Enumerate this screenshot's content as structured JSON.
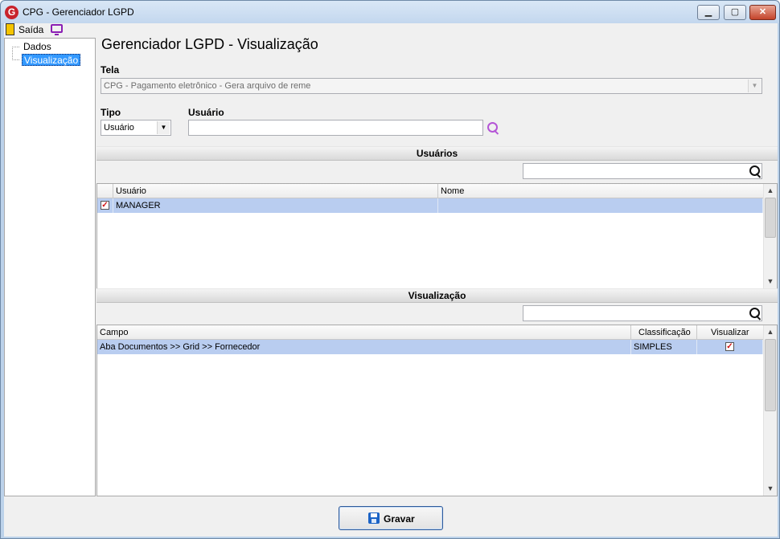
{
  "window": {
    "title": "CPG - Gerenciador LGPD",
    "app_icon_letter": "G"
  },
  "window_controls": {
    "minimize": "▁",
    "maximize": "▢",
    "close": "✕"
  },
  "toolbar": {
    "exit_label": "Saída",
    "exit_icon": "door-exit-icon",
    "monitor_icon": "monitor-icon"
  },
  "tree": {
    "items": [
      {
        "label": "Dados",
        "selected": false
      },
      {
        "label": "Visualização",
        "selected": true
      }
    ]
  },
  "main": {
    "title": "Gerenciador LGPD - Visualização",
    "tela": {
      "label": "Tela",
      "value": "CPG -  Pagamento eletrônico - Gera arquivo de reme",
      "enabled": false
    },
    "tipo": {
      "label": "Tipo",
      "value": "Usuário"
    },
    "usuario": {
      "label": "Usuário",
      "value": ""
    }
  },
  "usuarios_section": {
    "title": "Usuários",
    "filter_value": "",
    "columns": [
      "Usuário",
      "Nome"
    ],
    "rows": [
      {
        "checked": true,
        "usuario": "MANAGER",
        "nome": ""
      }
    ]
  },
  "visualizacao_section": {
    "title": "Visualização",
    "filter_value": "",
    "columns": [
      "Campo",
      "Classificação",
      "Visualizar"
    ],
    "rows": [
      {
        "campo": "Aba Documentos >> Grid >> Fornecedor",
        "classificacao": "SIMPLES",
        "visualizar": true
      }
    ]
  },
  "actions": {
    "save_label": "Gravar",
    "save_icon": "floppy-disk-icon"
  },
  "glyphs": {
    "dropdown_arrow": "▼",
    "scroll_up": "▲",
    "scroll_down": "▼",
    "check": "✓"
  },
  "colors": {
    "selection": "#3399ff",
    "row_highlight": "#b9cdf0",
    "search_icon": "#b455d6",
    "check_mark": "#d01010"
  }
}
